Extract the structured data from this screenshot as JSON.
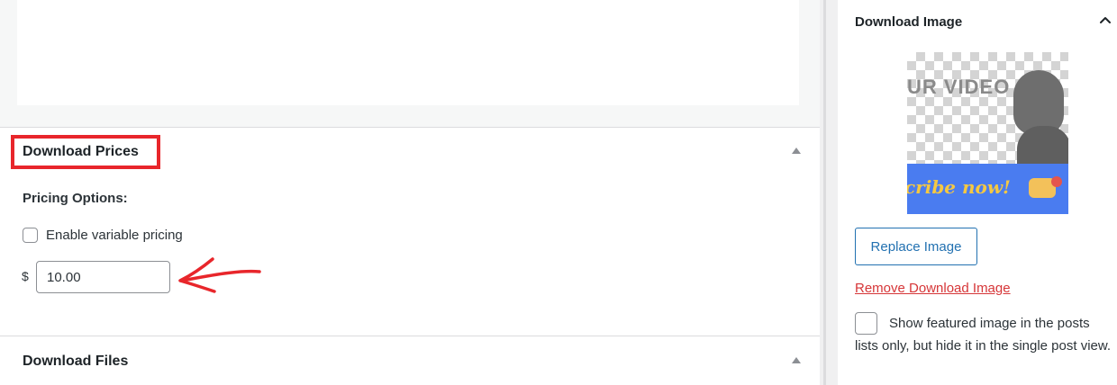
{
  "download_prices": {
    "title": "Download Prices",
    "pricing_options_label": "Pricing Options:",
    "variable_pricing_label": "Enable variable pricing",
    "variable_pricing_checked": false,
    "currency_symbol": "$",
    "price_value": "10.00"
  },
  "download_files": {
    "title": "Download Files"
  },
  "sidebar": {
    "download_image": {
      "title": "Download Image",
      "thumbnail_text": "UR VIDEO",
      "thumbnail_banner_text": "cribe now!",
      "replace_button_label": "Replace Image",
      "remove_link_label": "Remove Download Image",
      "featured_checkbox_label": "Show featured image in the posts lists only, but hide it in the single post view.",
      "featured_checked": false
    }
  },
  "icons": {
    "box_toggle": "arrow-up-triangle-icon",
    "sidebar_toggle": "chevron-up-icon"
  },
  "colors": {
    "highlight": "#e8262b",
    "link_blue": "#2271b1",
    "remove_red": "#d63638",
    "border_gray": "#8c8f94"
  }
}
